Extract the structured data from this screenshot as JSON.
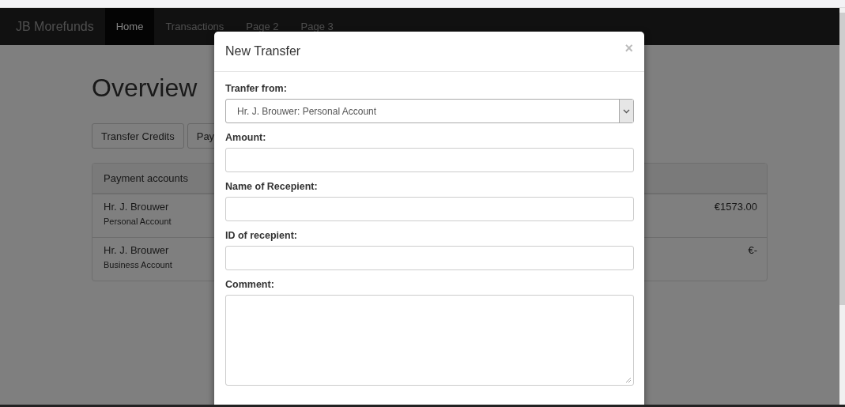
{
  "navbar": {
    "brand": "JB Morefunds",
    "items": [
      {
        "label": "Home",
        "selected": true
      },
      {
        "label": "Transactions",
        "selected": false
      },
      {
        "label": "Page 2",
        "selected": false
      },
      {
        "label": "Page 3",
        "selected": false
      }
    ]
  },
  "page": {
    "title": "Overview",
    "buttons": [
      "Transfer Credits",
      "Pay"
    ],
    "panel": {
      "heading": "Payment accounts",
      "rows": [
        {
          "holder": "Hr. J. Brouwer",
          "account": "Personal Account",
          "balance": "€1573.00"
        },
        {
          "holder": "Hr. J. Brouwer",
          "account": "Business Account",
          "balance": "€-"
        }
      ]
    }
  },
  "modal": {
    "title": "New Transfer",
    "close": "×",
    "fields": [
      {
        "kind": "select",
        "label": "Tranfer from:",
        "value": "Hr. J. Brouwer: Personal Account"
      },
      {
        "kind": "text",
        "label": "Amount:"
      },
      {
        "kind": "text",
        "label": "Name of Recepient:"
      },
      {
        "kind": "text",
        "label": "ID of recepient:"
      },
      {
        "kind": "textarea",
        "label": "Comment:"
      }
    ]
  }
}
